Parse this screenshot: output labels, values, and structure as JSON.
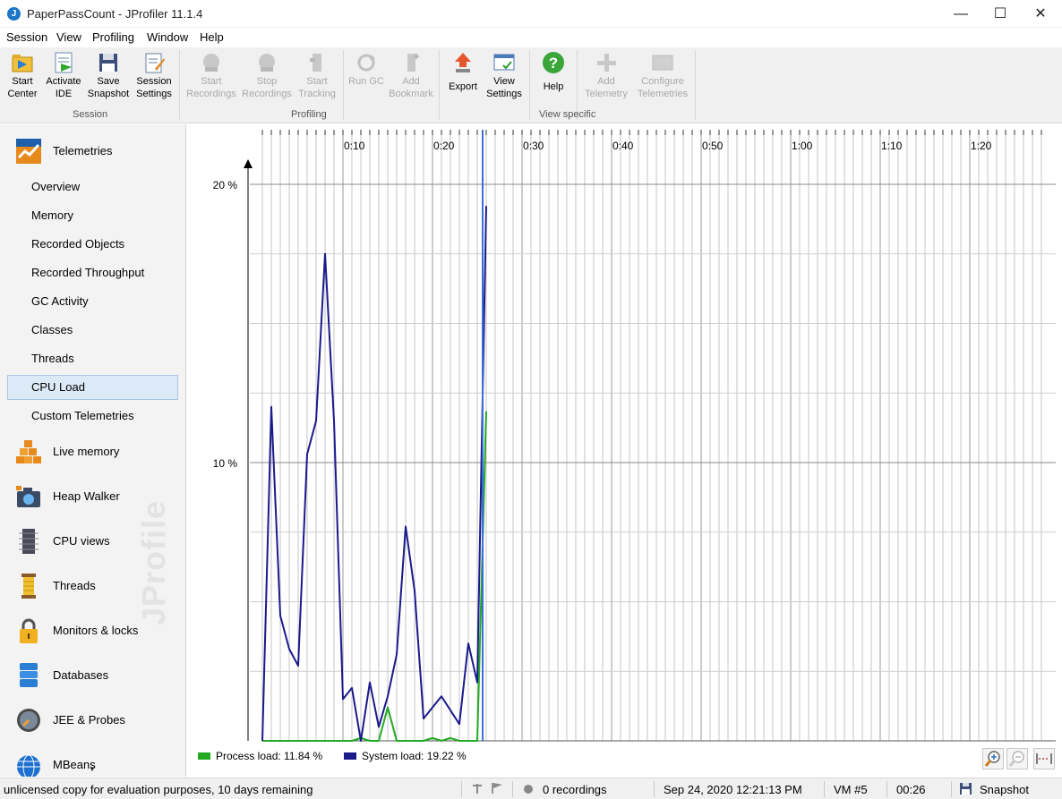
{
  "window": {
    "title": "PaperPassCount - JProfiler 11.1.4",
    "minimize_icon": "minimize-icon",
    "maximize_icon": "maximize-icon",
    "close_icon": "close-icon"
  },
  "menu": {
    "session": "Session",
    "view": "View",
    "profiling": "Profiling",
    "window": "Window",
    "help": "Help"
  },
  "toolbar": {
    "groups": {
      "session": "Session",
      "profiling": "Profiling",
      "view_specific": "View specific"
    },
    "start_center": [
      "Start",
      "Center"
    ],
    "activate_ide": [
      "Activate",
      "IDE"
    ],
    "save_snapshot": [
      "Save",
      "Snapshot"
    ],
    "session_settings": [
      "Session",
      "Settings"
    ],
    "start_recordings": [
      "Start",
      "Recordings"
    ],
    "stop_recordings": [
      "Stop",
      "Recordings"
    ],
    "start_tracking": [
      "Start",
      "Tracking"
    ],
    "run_gc": "Run GC",
    "add_bookmark": [
      "Add",
      "Bookmark"
    ],
    "export": "Export",
    "view_settings": [
      "View",
      "Settings"
    ],
    "help": "Help",
    "add_telemetry": [
      "Add",
      "Telemetry"
    ],
    "configure_telemetries": [
      "Configure",
      "Telemetries"
    ]
  },
  "sidebar": {
    "telemetries": "Telemetries",
    "sub_items": [
      "Overview",
      "Memory",
      "Recorded Objects",
      "Recorded Throughput",
      "GC Activity",
      "Classes",
      "Threads",
      "CPU Load",
      "Custom Telemetries"
    ],
    "selected": "CPU Load",
    "sections": [
      "Live memory",
      "Heap Walker",
      "CPU views",
      "Threads",
      "Monitors & locks",
      "Databases",
      "JEE & Probes",
      "MBeans"
    ],
    "watermark": "JProfiler"
  },
  "chart_data": {
    "type": "line",
    "x_unit": "m:ss",
    "x_tick_labels": [
      "0:10",
      "0:20",
      "0:30",
      "0:40",
      "0:50",
      "1:00",
      "1:10",
      "1:20"
    ],
    "y_tick_labels": [
      "20 %",
      "10 %"
    ],
    "ylim": [
      0,
      20
    ],
    "xlim_seconds": [
      1,
      88
    ],
    "grid": true,
    "current_time_marker_seconds": 26,
    "series": [
      {
        "name": "System load",
        "color": "#1a1a8c",
        "x": [
          1,
          2,
          3,
          4,
          5,
          6,
          7,
          8,
          9,
          10,
          11,
          12,
          13,
          14,
          15,
          16,
          17,
          18,
          19,
          20,
          21,
          22,
          23,
          24,
          25,
          26
        ],
        "values": [
          0,
          12.0,
          4.5,
          3.3,
          2.7,
          10.3,
          11.5,
          17.5,
          11.5,
          1.5,
          1.9,
          0,
          2.1,
          0.5,
          1.6,
          3.1,
          7.7,
          5.4,
          0.8,
          1.2,
          1.6,
          1.1,
          0.6,
          3.5,
          2.1,
          19.22
        ]
      },
      {
        "name": "Process load",
        "color": "#22aa22",
        "x": [
          1,
          2,
          3,
          4,
          5,
          6,
          7,
          8,
          9,
          10,
          11,
          12,
          13,
          14,
          15,
          16,
          17,
          18,
          19,
          20,
          21,
          22,
          23,
          24,
          25,
          26
        ],
        "values": [
          0,
          0,
          0,
          0,
          0,
          0,
          0,
          0,
          0,
          0,
          0,
          0.1,
          0,
          0,
          1.2,
          0,
          0,
          0,
          0,
          0.1,
          0,
          0.1,
          0,
          0,
          0,
          11.84
        ]
      }
    ]
  },
  "legend": {
    "process": "Process load: 11.84 %",
    "system": "System load: 19.22 %",
    "process_color": "#22aa22",
    "system_color": "#1a1a8c"
  },
  "status": {
    "license": "unlicensed copy for evaluation purposes, 10 days remaining",
    "recordings": "0 recordings",
    "datetime": "Sep 24, 2020 12:21:13 PM",
    "vm": "VM #5",
    "elapsed": "00:26",
    "mode": "Snapshot"
  }
}
